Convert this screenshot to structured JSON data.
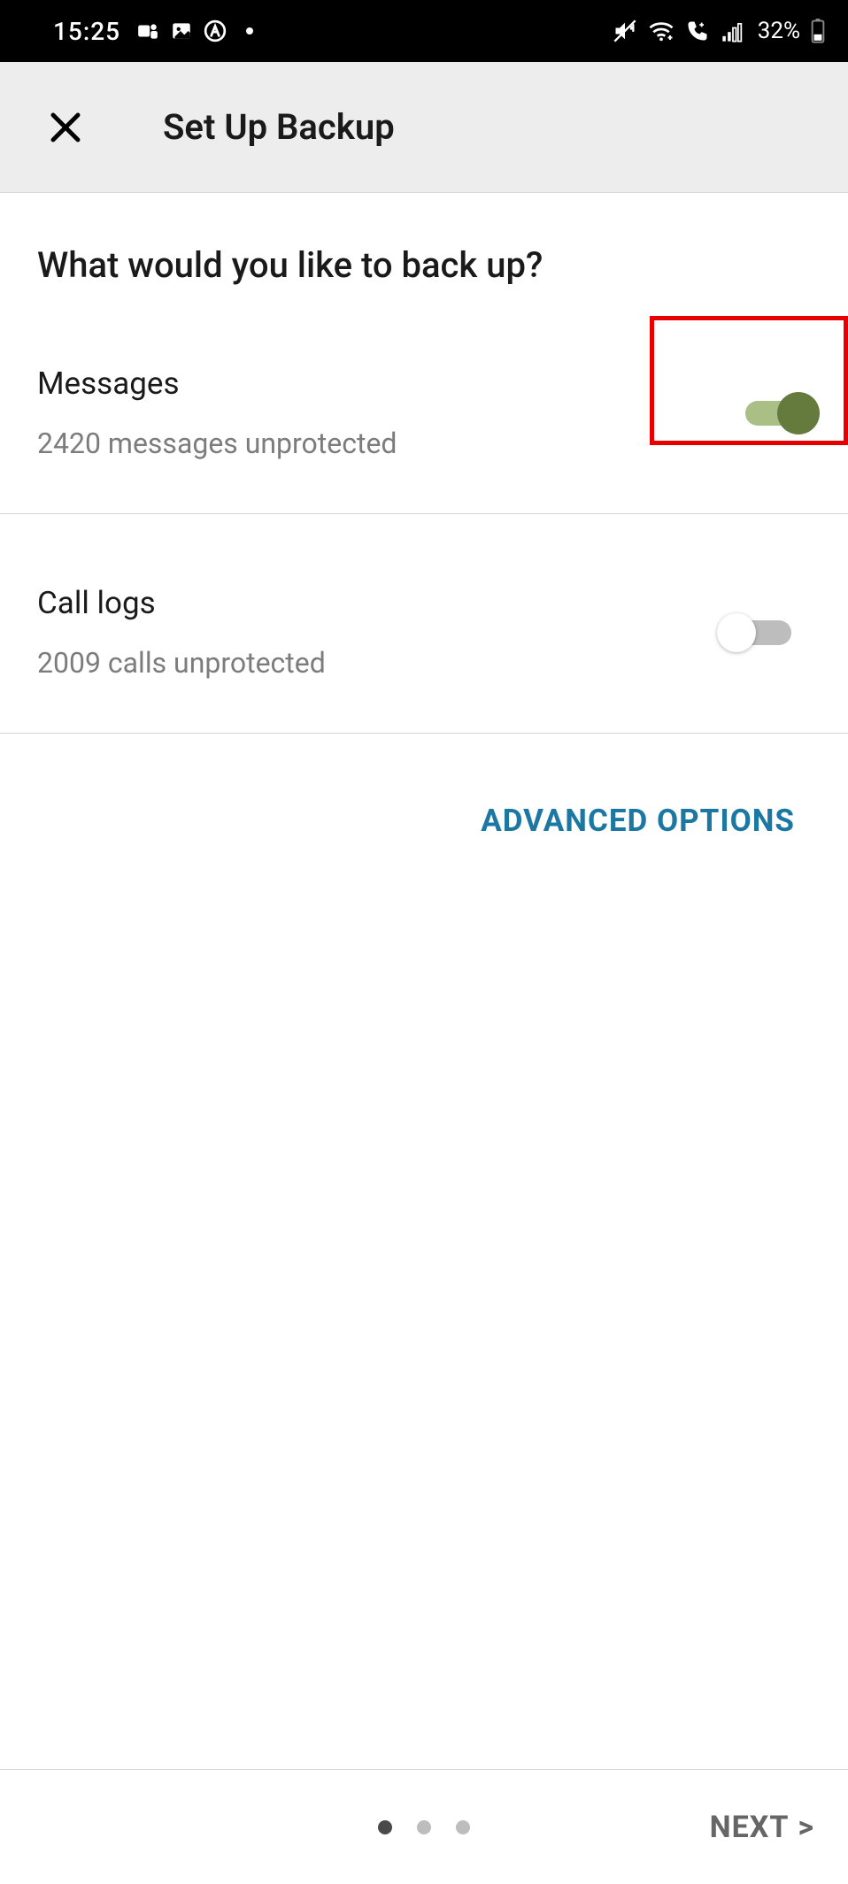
{
  "status_bar": {
    "time": "15:25",
    "battery_text": "32%",
    "icons_left": [
      "teams-icon",
      "image-icon",
      "circle-a-icon"
    ],
    "icons_right": [
      "mute-icon",
      "wifi-icon",
      "call-icon",
      "signal-icon"
    ]
  },
  "app_bar": {
    "title": "Set Up Backup"
  },
  "content": {
    "heading": "What would you like to back up?",
    "items": [
      {
        "title": "Messages",
        "subtitle": "2420 messages unprotected",
        "enabled": true,
        "highlighted": true
      },
      {
        "title": "Call logs",
        "subtitle": "2009 calls unprotected",
        "enabled": false,
        "highlighted": false
      }
    ],
    "advanced_label": "ADVANCED OPTIONS"
  },
  "footer": {
    "page_count": 3,
    "active_page": 0,
    "next_label": "NEXT"
  }
}
